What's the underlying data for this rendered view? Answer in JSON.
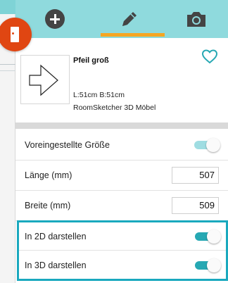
{
  "tabs": [
    {
      "name": "add",
      "icon": "plus-circle-icon"
    },
    {
      "name": "edit",
      "icon": "pencil-icon",
      "active": true
    },
    {
      "name": "camera",
      "icon": "camera-icon"
    }
  ],
  "object": {
    "title": "Pfeil groß",
    "dimensions": "L:51cm B:51cm",
    "source": "RoomSketcher 3D Möbel",
    "favorite_icon": "heart-outline-icon"
  },
  "settings": {
    "preset_size": {
      "label": "Voreingestellte Größe",
      "on": true,
      "enabled": false
    },
    "length": {
      "label": "Länge (mm)",
      "value": "507"
    },
    "width": {
      "label": "Breite (mm)",
      "value": "509"
    },
    "show_2d": {
      "label": "In 2D darstellen",
      "on": true
    },
    "show_3d": {
      "label": "In 3D darstellen",
      "on": true
    }
  },
  "colors": {
    "toolbar": "#8fdadd",
    "active_tab": "#f5a623",
    "accent": "#26a8b3",
    "door_button": "#e04612",
    "highlight": "#1aa9be"
  }
}
